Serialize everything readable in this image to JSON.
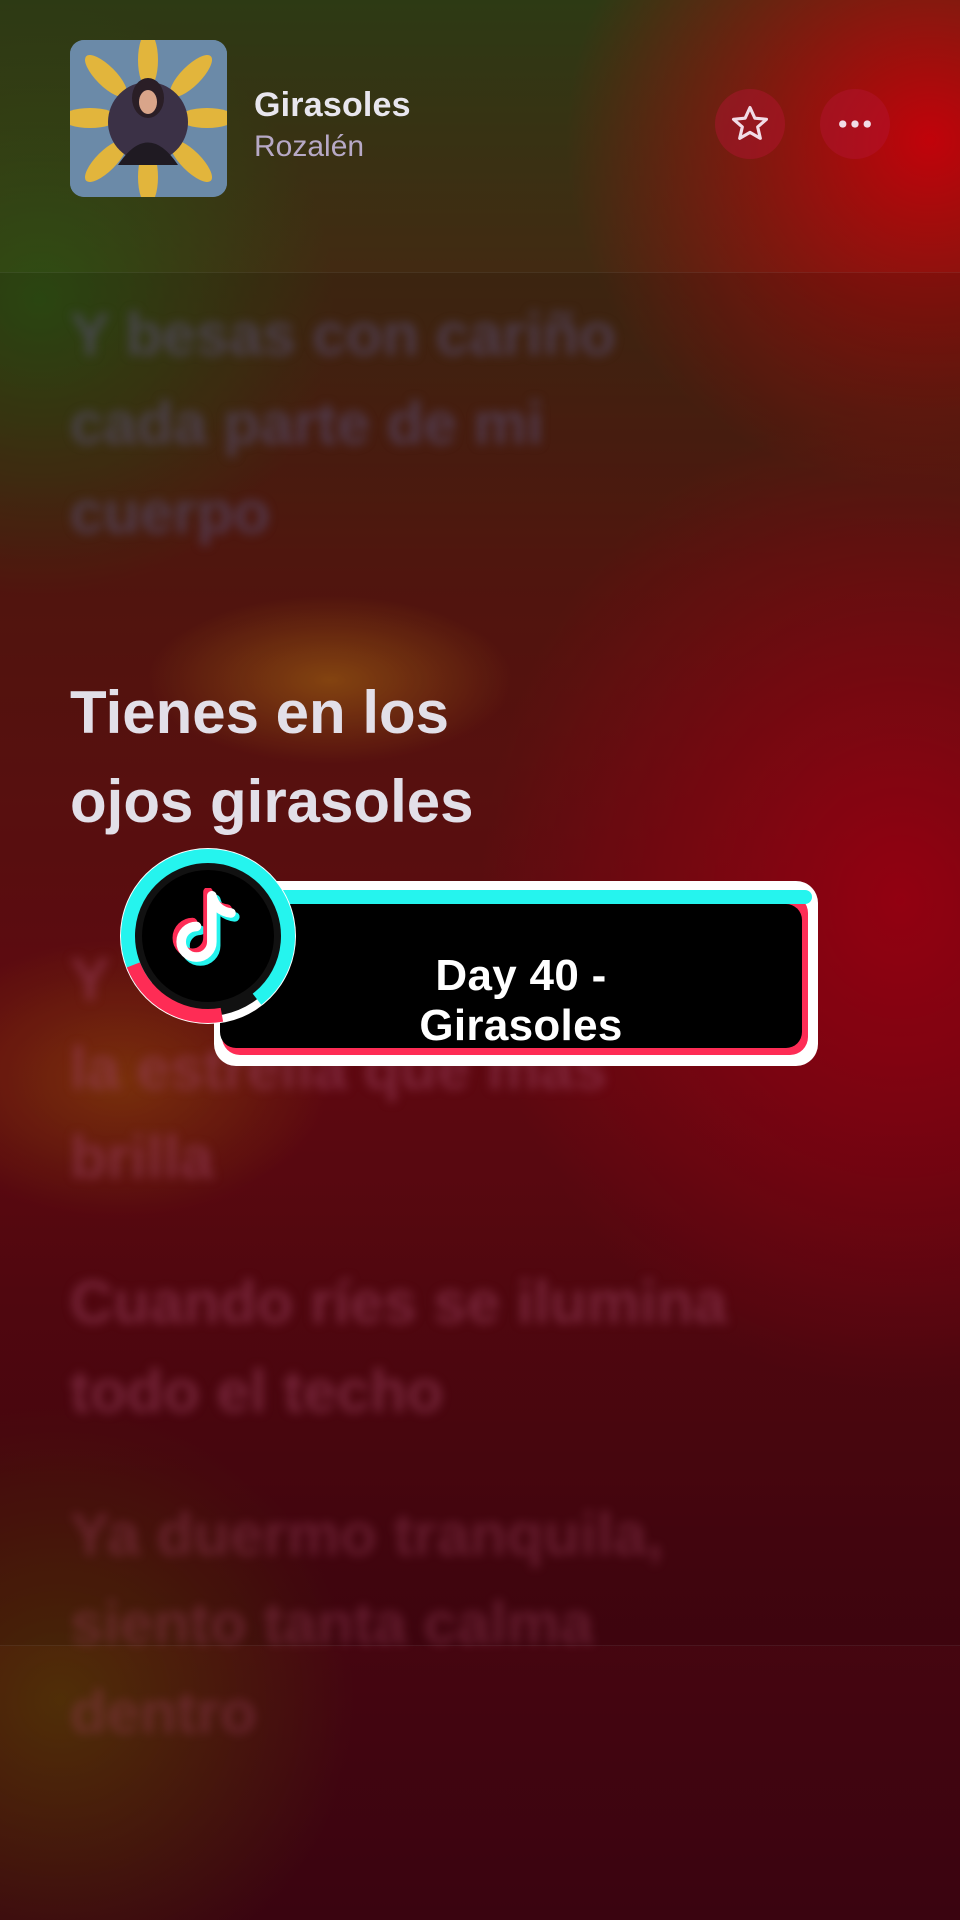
{
  "song": {
    "title": "Girasoles",
    "artist": "Rozalén"
  },
  "lyrics": {
    "previous": [
      "Y besas con cariño",
      "cada parte de mi",
      "cuerpo"
    ],
    "current": [
      "Tienes en los",
      "ojos girasoles"
    ],
    "next_1": [
      "Y",
      "la estrella que más",
      "brilla"
    ],
    "next_2": [
      "Cuando ríes se ilumina",
      "todo el techo"
    ],
    "next_3": [
      "Ya duermo tranquila,",
      "siento tanta calma",
      "dentro"
    ]
  },
  "badge": {
    "label": "Day 40 - Girasoles",
    "logo": "tiktok-logo"
  },
  "icons": {
    "favorite": "star-icon",
    "more": "more-icon"
  },
  "colors": {
    "tiktok_cyan": "#25F4EE",
    "tiktok_red": "#FE2C55"
  }
}
